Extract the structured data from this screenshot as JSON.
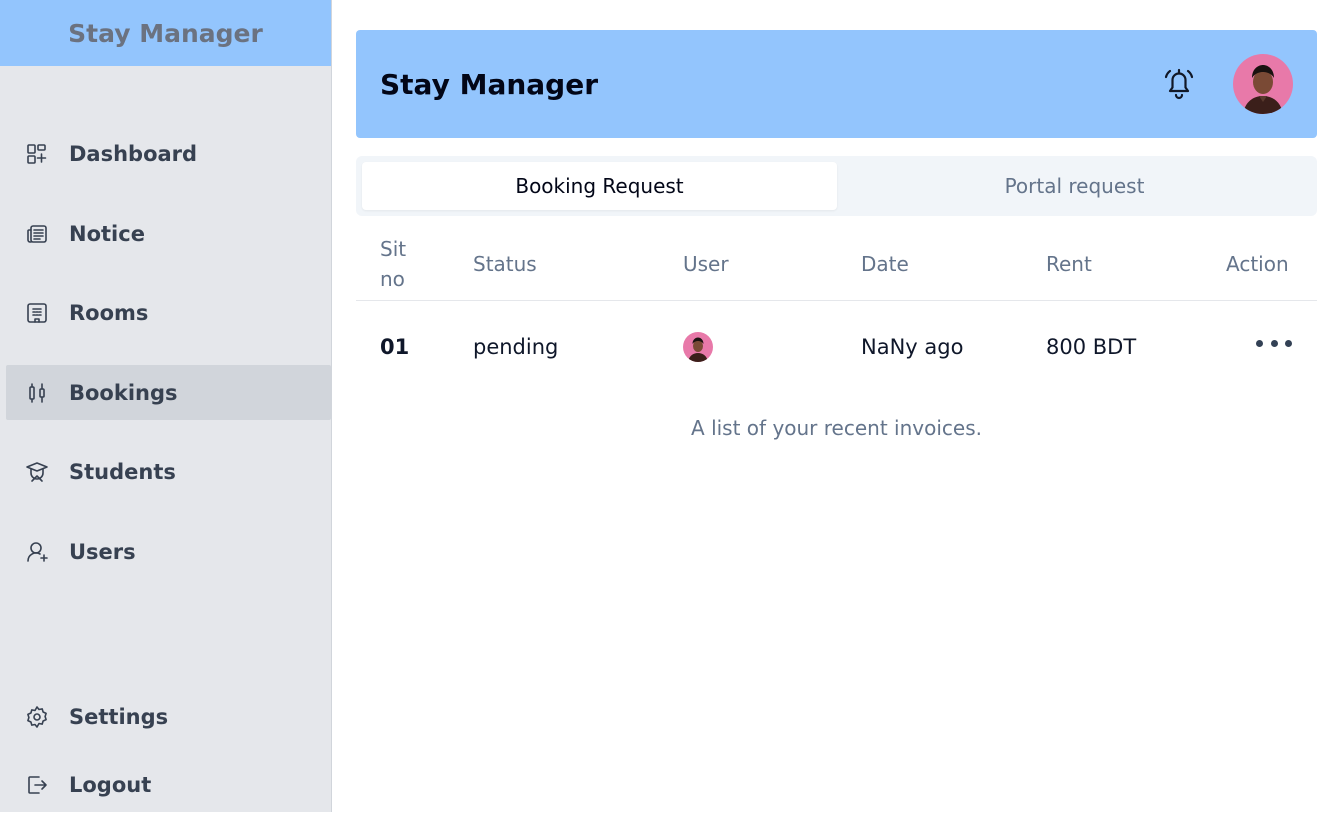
{
  "sidebar": {
    "brand": "Stay Manager",
    "items": [
      {
        "label": "Dashboard",
        "icon": "dashboard-icon",
        "active": false
      },
      {
        "label": "Notice",
        "icon": "newspaper-icon",
        "active": false
      },
      {
        "label": "Rooms",
        "icon": "building-icon",
        "active": false
      },
      {
        "label": "Bookings",
        "icon": "candlestick-icon",
        "active": true
      },
      {
        "label": "Students",
        "icon": "graduation-cap-icon",
        "active": false
      },
      {
        "label": "Users",
        "icon": "user-plus-icon",
        "active": false
      }
    ],
    "footer": [
      {
        "label": "Settings",
        "icon": "gear-icon"
      },
      {
        "label": "Logout",
        "icon": "logout-icon"
      }
    ]
  },
  "header": {
    "title": "Stay Manager",
    "notification_icon": "bell-icon",
    "avatar_icon": "avatar-icon"
  },
  "tabs": [
    {
      "label": "Booking Request",
      "active": true
    },
    {
      "label": "Portal request",
      "active": false
    }
  ],
  "table": {
    "columns": {
      "sit_line1": "Sit",
      "sit_line2": "no",
      "status": "Status",
      "user": "User",
      "date": "Date",
      "rent": "Rent",
      "action": "Action"
    },
    "rows": [
      {
        "sit_no": "01",
        "status": "pending",
        "date": "NaNy ago",
        "rent": "800 BDT"
      }
    ],
    "caption": "A list of your recent invoices."
  },
  "colors": {
    "brand_bg": "#93c5fd",
    "sidebar_bg": "#e5e7eb",
    "active_item_bg": "#d1d5db",
    "avatar_bg": "#e879a9"
  }
}
